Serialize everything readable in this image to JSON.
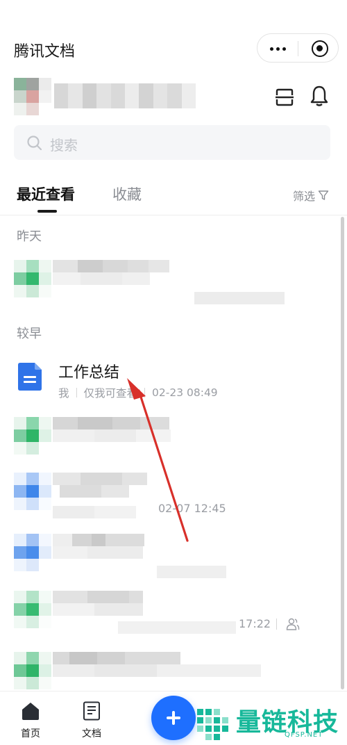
{
  "app": {
    "title": "腾讯文档"
  },
  "search": {
    "placeholder": "搜索"
  },
  "tabs": {
    "recent": "最近查看",
    "favorites": "收藏",
    "filter": "筛选"
  },
  "sections": {
    "yesterday": "昨天",
    "earlier": "较早"
  },
  "featured_doc": {
    "title": "工作总结",
    "owner": "我",
    "permission": "仅我可查看",
    "time": "02-23 08:49"
  },
  "blurred_meta": {
    "time_1": "02-07 12:45",
    "time_2": "17:22"
  },
  "bottom_nav": {
    "home": "首页",
    "docs": "文档"
  },
  "watermark": {
    "text": "量链科技",
    "url": "QFSP.NET"
  },
  "colors": {
    "accent": "#1e6fff",
    "arrow": "#d8302a",
    "watermark": "#17b89a"
  }
}
